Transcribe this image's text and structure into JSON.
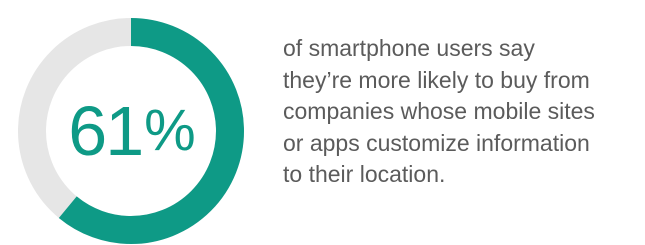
{
  "chart_data": {
    "type": "pie",
    "variant": "donut",
    "values": [
      61,
      39
    ],
    "value_label": "61",
    "unit": "%",
    "colors": {
      "filled": "#0e9a86",
      "remaining": "#e6e6e6"
    }
  },
  "description_lines": [
    "of smartphone users say",
    "they’re more likely to buy from",
    "companies whose mobile sites",
    "or apps customize information",
    "to their location."
  ]
}
